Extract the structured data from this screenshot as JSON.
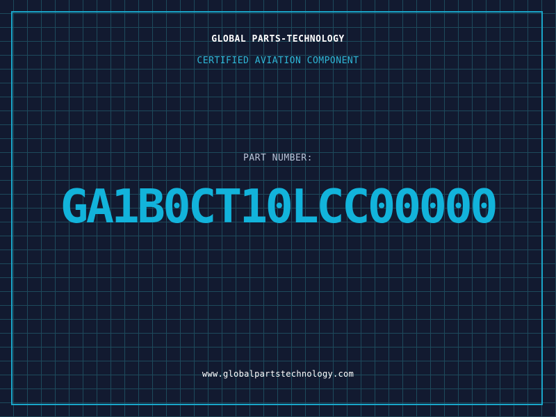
{
  "label": {
    "company": "GLOBAL PARTS-TECHNOLOGY",
    "subtitle": "CERTIFIED AVIATION COMPONENT",
    "part_number_label": "PART NUMBER:",
    "part_number": "GA1B0CT10LCC00000",
    "website": "www.globalpartstechnology.com"
  },
  "colors": {
    "background": "#121a30",
    "grid": "#1d4a5c",
    "accent": "#12b3db",
    "frame": "#1aa6c9"
  }
}
